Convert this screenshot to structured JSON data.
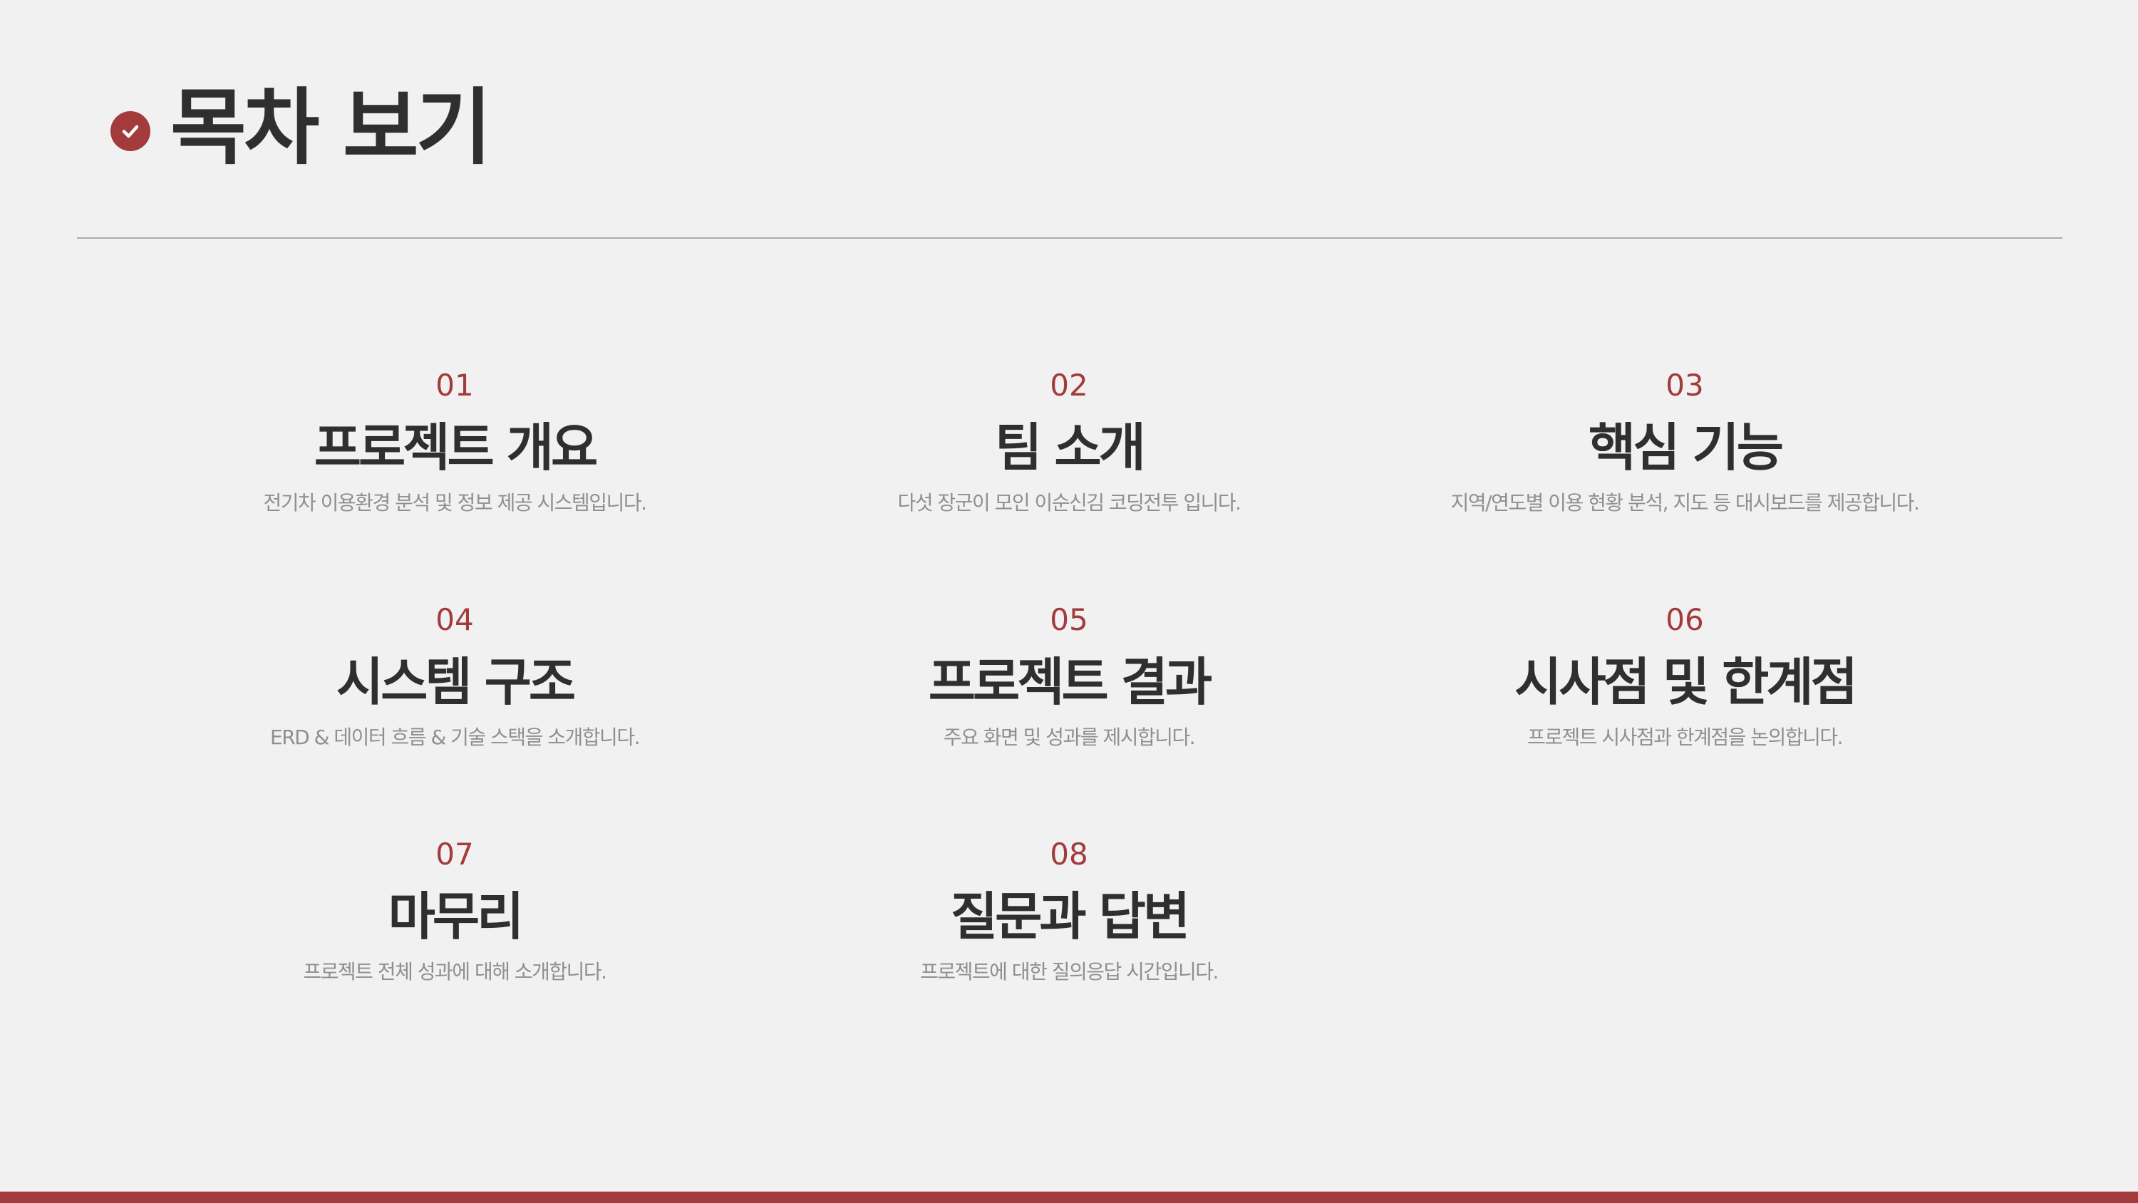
{
  "header": {
    "title": "목차 보기",
    "icon": "check-circle-icon",
    "accent_color": "#a33a3c"
  },
  "items": [
    {
      "num": "01",
      "title": "프로젝트 개요",
      "desc": "전기차 이용환경 분석 및 정보 제공 시스템입니다."
    },
    {
      "num": "02",
      "title": "팀 소개",
      "desc": "다섯 장군이 모인 이순신김 코딩전투 입니다."
    },
    {
      "num": "03",
      "title": "핵심 기능",
      "desc": "지역/연도별 이용 현황 분석, 지도 등 대시보드를 제공합니다."
    },
    {
      "num": "04",
      "title": "시스템 구조",
      "desc": "ERD & 데이터 흐름 & 기술 스택을 소개합니다."
    },
    {
      "num": "05",
      "title": "프로젝트 결과",
      "desc": "주요 화면 및 성과를 제시합니다."
    },
    {
      "num": "06",
      "title": "시사점 및 한계점",
      "desc": "프로젝트 시사점과 한계점을 논의합니다."
    },
    {
      "num": "07",
      "title": "마무리",
      "desc": "프로젝트 전체 성과에 대해 소개합니다."
    },
    {
      "num": "08",
      "title": "질문과 답변",
      "desc": "프로젝트에 대한 질의응답 시간입니다."
    }
  ]
}
